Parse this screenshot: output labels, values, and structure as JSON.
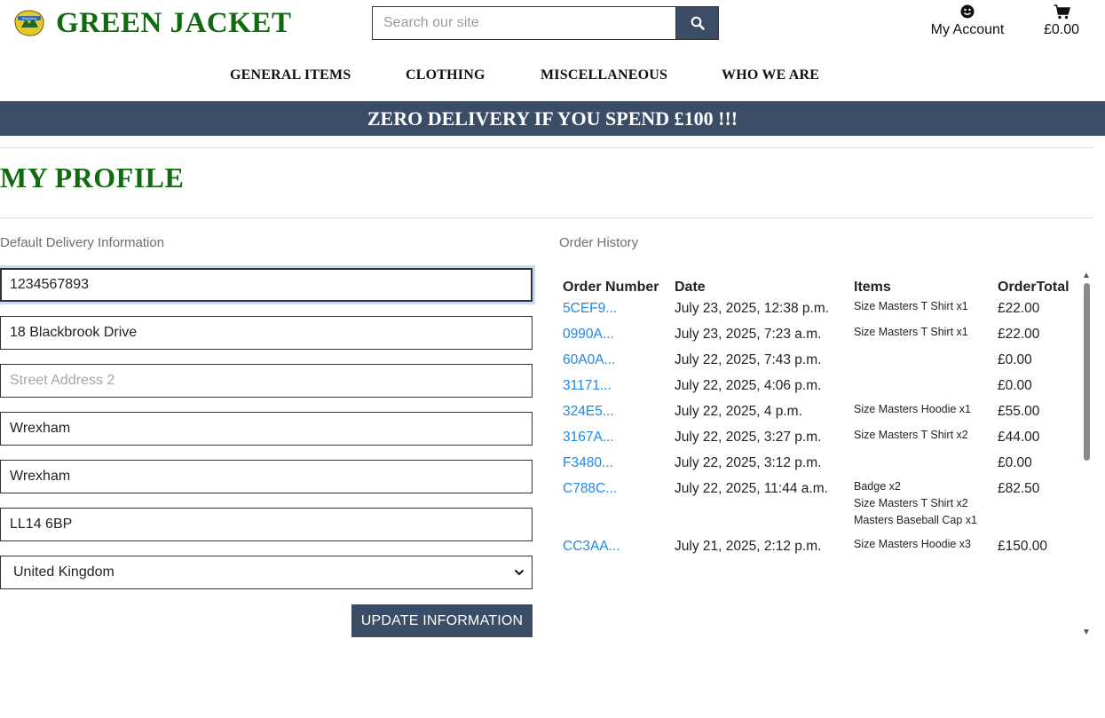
{
  "header": {
    "brand": "GREEN JACKET",
    "logo_icon": "masters-logo-icon",
    "search_placeholder": "Search our site",
    "search_icon": "search-icon",
    "account_label": "My Account",
    "account_icon": "smiley-face-icon",
    "bag_total": "£0.00",
    "bag_icon": "shopping-cart-icon"
  },
  "nav": {
    "items": [
      "GENERAL ITEMS",
      "CLOTHING",
      "MISCELLANEOUS",
      "WHO WE ARE"
    ]
  },
  "banner": {
    "text": "ZERO DELIVERY IF YOU SPEND £100 !!!"
  },
  "profile": {
    "title": "MY PROFILE",
    "delivery_heading": "Default Delivery Information",
    "fields": {
      "phone": "1234567893",
      "street1": "18 Blackbrook Drive",
      "street2": "",
      "street2_placeholder": "Street Address 2",
      "town": "Wrexham",
      "county": "Wrexham",
      "postcode": "LL14 6BP",
      "country": "United Kingdom"
    },
    "update_button": "UPDATE INFORMATION"
  },
  "orders": {
    "heading": "Order History",
    "columns": [
      "Order Number",
      "Date",
      "Items",
      "OrderTotal"
    ],
    "rows": [
      {
        "number": "5CEF9...",
        "date": "July 23, 2025, 12:38 p.m.",
        "items": [
          "Size Masters T Shirt x1"
        ],
        "total": "£22.00"
      },
      {
        "number": "0990A...",
        "date": "July 23, 2025, 7:23 a.m.",
        "items": [
          "Size Masters T Shirt x1"
        ],
        "total": "£22.00"
      },
      {
        "number": "60A0A...",
        "date": "July 22, 2025, 7:43 p.m.",
        "items": [],
        "total": "£0.00"
      },
      {
        "number": "31171...",
        "date": "July 22, 2025, 4:06 p.m.",
        "items": [],
        "total": "£0.00"
      },
      {
        "number": "324E5...",
        "date": "July 22, 2025, 4 p.m.",
        "items": [
          "Size Masters Hoodie x1"
        ],
        "total": "£55.00"
      },
      {
        "number": "3167A...",
        "date": "July 22, 2025, 3:27 p.m.",
        "items": [
          "Size Masters T Shirt x2"
        ],
        "total": "£44.00"
      },
      {
        "number": "F3480...",
        "date": "July 22, 2025, 3:12 p.m.",
        "items": [],
        "total": "£0.00"
      },
      {
        "number": "C788C...",
        "date": "July 22, 2025, 11:44 a.m.",
        "items": [
          "Badge x2",
          "Size Masters T Shirt x2",
          "Masters Baseball Cap x1"
        ],
        "total": "£82.50"
      },
      {
        "number": "CC3AA...",
        "date": "July 21, 2025, 2:12 p.m.",
        "items": [
          "Size Masters Hoodie x3"
        ],
        "total": "£150.00"
      }
    ]
  },
  "colors": {
    "brand_green": "#0e6b0e",
    "navy": "#3b4c66",
    "link_blue": "#1e88e5"
  }
}
